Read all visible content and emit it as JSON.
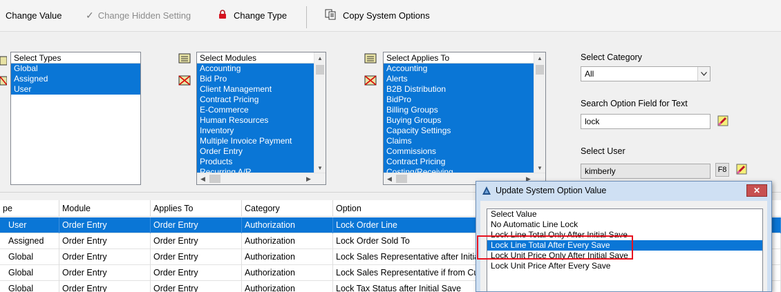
{
  "toolbar": {
    "change_value": "Change Value",
    "change_hidden_setting": "Change Hidden Setting",
    "change_type": "Change Type",
    "copy_system_options": "Copy System Options"
  },
  "filters": {
    "types": {
      "header": "Select Types",
      "items": [
        {
          "label": "Global",
          "selected": true
        },
        {
          "label": "Assigned",
          "selected": true
        },
        {
          "label": "User",
          "selected": true
        }
      ]
    },
    "modules": {
      "header": "Select Modules",
      "items": [
        {
          "label": "Accounting",
          "selected": true
        },
        {
          "label": "Bid Pro",
          "selected": true
        },
        {
          "label": "Client Management",
          "selected": true
        },
        {
          "label": "Contract Pricing",
          "selected": true
        },
        {
          "label": "E-Commerce",
          "selected": true
        },
        {
          "label": "Human Resources",
          "selected": true
        },
        {
          "label": "Inventory",
          "selected": true
        },
        {
          "label": "Multiple Invoice Payment",
          "selected": true
        },
        {
          "label": "Order Entry",
          "selected": true
        },
        {
          "label": "Products",
          "selected": true
        },
        {
          "label": "Recurring A/R",
          "selected": true
        }
      ]
    },
    "applies_to": {
      "header": "Select Applies To",
      "items": [
        {
          "label": "Accounting",
          "selected": true
        },
        {
          "label": "Alerts",
          "selected": true
        },
        {
          "label": "B2B Distribution",
          "selected": true
        },
        {
          "label": "BidPro",
          "selected": true
        },
        {
          "label": "Billing Groups",
          "selected": true
        },
        {
          "label": "Buying Groups",
          "selected": true
        },
        {
          "label": "Capacity Settings",
          "selected": true
        },
        {
          "label": "Claims",
          "selected": true
        },
        {
          "label": "Commissions",
          "selected": true
        },
        {
          "label": "Contract Pricing",
          "selected": true
        },
        {
          "label": "Costing/Receiving",
          "selected": true
        }
      ]
    },
    "category": {
      "label": "Select Category",
      "value": "All"
    },
    "search": {
      "label": "Search Option Field for Text",
      "value": "lock"
    },
    "user": {
      "label": "Select User",
      "value": "kimberly",
      "f8_label": "F8"
    }
  },
  "grid": {
    "columns": {
      "type": "pe",
      "module": "Module",
      "applies_to": "Applies To",
      "category": "Category",
      "option": "Option"
    },
    "rows": [
      {
        "type": "User",
        "module": "Order Entry",
        "applies_to": "Order Entry",
        "category": "Authorization",
        "option": "Lock Order Line",
        "selected": true
      },
      {
        "type": "Assigned",
        "module": "Order Entry",
        "applies_to": "Order Entry",
        "category": "Authorization",
        "option": "Lock Order Sold To",
        "selected": false
      },
      {
        "type": "Global",
        "module": "Order Entry",
        "applies_to": "Order Entry",
        "category": "Authorization",
        "option": "Lock Sales Representative after Initial Save",
        "selected": false
      },
      {
        "type": "Global",
        "module": "Order Entry",
        "applies_to": "Order Entry",
        "category": "Authorization",
        "option": "Lock Sales Representative if from Customer",
        "selected": false
      },
      {
        "type": "Global",
        "module": "Order Entry",
        "applies_to": "Order Entry",
        "category": "Authorization",
        "option": "Lock Tax Status after Initial Save",
        "selected": false
      }
    ]
  },
  "dialog": {
    "title": "Update System Option Value",
    "close_label": "✕",
    "options": [
      {
        "label": "Select Value",
        "selected": false
      },
      {
        "label": "No Automatic Line Lock",
        "selected": false
      },
      {
        "label": "Lock Line Total Only After Initial Save",
        "selected": false
      },
      {
        "label": "Lock Line Total After Every Save",
        "selected": true
      },
      {
        "label": "Lock Unit Price Only After Initial Save",
        "selected": false
      },
      {
        "label": "Lock Unit Price After Every Save",
        "selected": false
      }
    ]
  },
  "colors": {
    "selection": "#0a76d6",
    "highlight_box": "#e8121f",
    "dialog_frame": "#cfe0f3"
  },
  "icons": {
    "change_value": "check-icon",
    "change_hidden_setting": "check-icon",
    "change_type": "lock-icon",
    "copy_system_options": "copy-icon",
    "select_all": "select-all-icon",
    "clear_all": "clear-all-icon",
    "clear_field": "eraser-icon",
    "dialog": "app-logo-icon"
  }
}
